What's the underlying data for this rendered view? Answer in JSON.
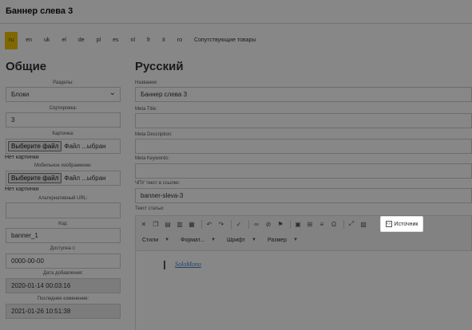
{
  "header": {
    "title": "Баннер слева 3"
  },
  "languages": [
    "ru",
    "en",
    "uk",
    "el",
    "de",
    "pl",
    "es",
    "nl",
    "fr",
    "it",
    "ro",
    "Сопутствующие товары"
  ],
  "active_language": "ru",
  "left": {
    "heading": "Общие",
    "section_label": "Разделы:",
    "section_value": "Блоки",
    "sort_label": "Сортировка:",
    "sort_value": "3",
    "image_label": "Картинка:",
    "choose_file": "Выберите файл",
    "file_status": "Файл ...ыбран",
    "no_image": "Нет картинки",
    "mobile_label": "Мобильное изображение:",
    "mobile_choose_file": "Выберите файл",
    "mobile_file_status": "Файл ...ыбран",
    "mobile_no_image": "Нет картинки",
    "alt_label": "Альтернативный URL:",
    "alt_value": "",
    "code_label": "Код:",
    "code_value": "banner_1",
    "available_label": "Доступна с:",
    "available_value": "0000-00-00",
    "added_label": "Дата добавления:",
    "added_value": "2020-01-14 00:03:16",
    "modified_label": "Последнее изменение:",
    "modified_value": "2021-01-26 10:51:38"
  },
  "right": {
    "heading": "Русский",
    "name_label": "Название:",
    "name_value": "Баннер слева 3",
    "meta_title_label": "Meta Title:",
    "meta_title_value": "",
    "meta_desc_label": "Meta Description:",
    "meta_desc_value": "",
    "meta_kw_label": "Meta Keywords:",
    "meta_kw_value": "",
    "url_label": "ЧПУ текст в ссылке:",
    "url_value": "banner-sleva-3",
    "text_label": "Текст статьи:"
  },
  "editor": {
    "source_label": "Источник",
    "styles_label": "Стили",
    "format_label": "Формат...",
    "font_label": "Шрифт",
    "size_label": "Размер",
    "content_link": "SoloMono"
  },
  "overlay_color": "rgba(0,0,0,0.47)",
  "accent_color": "#f2c200"
}
